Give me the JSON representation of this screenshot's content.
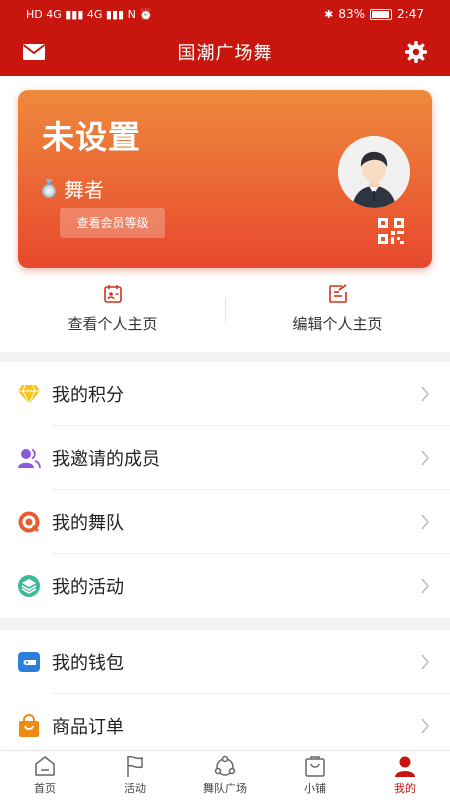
{
  "status_bar": {
    "left_glyphs": "HD 4G ▮▮▮ 4G ▮▮▮ N ⏰",
    "bluetooth": "✱",
    "battery_percent": "83%",
    "time": "2:47",
    "battery_level": 0.83
  },
  "header": {
    "title": "国潮广场舞",
    "left_icon": "mail-icon",
    "right_icon": "gear-icon"
  },
  "profile": {
    "nickname": "未设置",
    "role": "舞者",
    "level_button": "查看会员等级",
    "avatar_icon": "avatar-icon",
    "qr_icon": "qr-code-icon"
  },
  "quick_actions": [
    {
      "label": "查看个人主页",
      "icon": "profile-card-icon"
    },
    {
      "label": "编辑个人主页",
      "icon": "edit-icon"
    }
  ],
  "menu_group1": [
    {
      "label": "我的积分",
      "icon": "diamond-icon"
    },
    {
      "label": "我邀请的成员",
      "icon": "members-icon"
    },
    {
      "label": "我的舞队",
      "icon": "team-icon"
    },
    {
      "label": "我的活动",
      "icon": "activity-icon"
    }
  ],
  "menu_group2": [
    {
      "label": "我的钱包",
      "icon": "wallet-icon"
    },
    {
      "label": "商品订单",
      "icon": "shopping-bag-icon"
    }
  ],
  "tabs": [
    {
      "label": "首页",
      "icon": "home-icon",
      "active": false
    },
    {
      "label": "活动",
      "icon": "flag-icon",
      "active": false
    },
    {
      "label": "舞队广场",
      "icon": "square-icon",
      "active": false
    },
    {
      "label": "小铺",
      "icon": "shop-icon",
      "active": false
    },
    {
      "label": "我的",
      "icon": "user-icon",
      "active": true
    }
  ],
  "colors": {
    "brand_red": "#c8160f",
    "card_gradient_top": "#ee8a3c",
    "card_gradient_bottom": "#e8482e"
  }
}
